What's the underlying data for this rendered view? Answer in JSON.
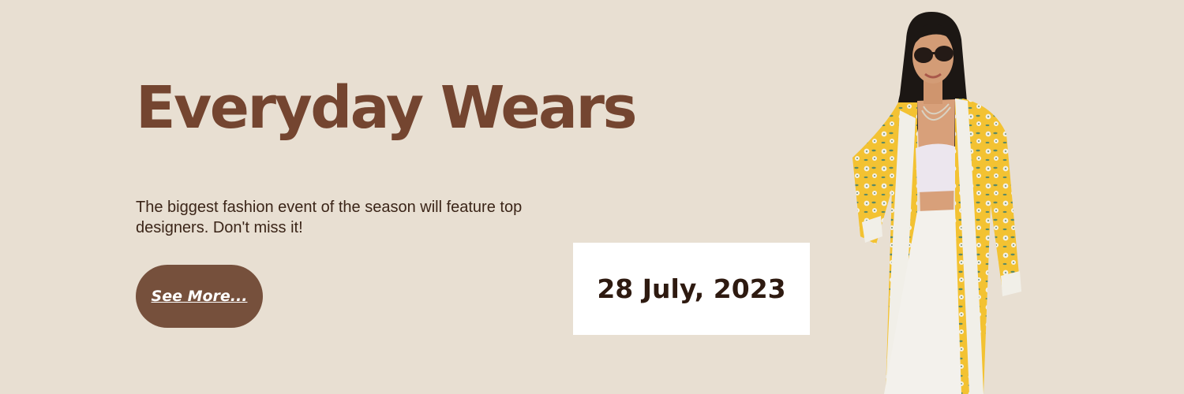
{
  "banner": {
    "title": "Everyday Wears",
    "description": "The biggest fashion event of the season will feature top designers. Don't miss it!",
    "cta_label": "See More...",
    "event_date": "28 July, 2023",
    "colors": {
      "background": "#e8dfd2",
      "title": "#744530",
      "button": "#76503c",
      "date_box": "#ffffff",
      "body_text": "#3b2518"
    },
    "image": "fashion-model-photo"
  }
}
